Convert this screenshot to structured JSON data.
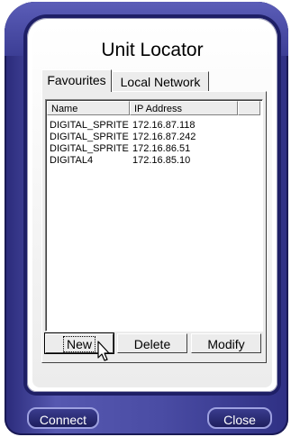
{
  "window": {
    "title": "Unit Locator"
  },
  "tabs": [
    {
      "label": "Favourites",
      "active": true
    },
    {
      "label": "Local Network",
      "active": false
    }
  ],
  "list": {
    "columns": [
      "Name",
      "IP Address"
    ],
    "rows": [
      {
        "name": "DIGITAL_SPRITE",
        "ip": "172.16.87.118"
      },
      {
        "name": "DIGITAL_SPRITE",
        "ip": "172.16.87.242"
      },
      {
        "name": "DIGITAL_SPRITE",
        "ip": "172.16.86.51"
      },
      {
        "name": "DIGITAL4",
        "ip": "172.16.85.10"
      }
    ]
  },
  "actions": {
    "new": "New",
    "delete": "Delete",
    "modify": "Modify"
  },
  "footer": {
    "connect": "Connect",
    "close": "Close"
  },
  "colors": {
    "frame": "#4a4ca4",
    "frame_dark": "#1e1f66",
    "panel": "#ececec"
  },
  "icons": {
    "cursor": "arrow-cursor-icon"
  }
}
